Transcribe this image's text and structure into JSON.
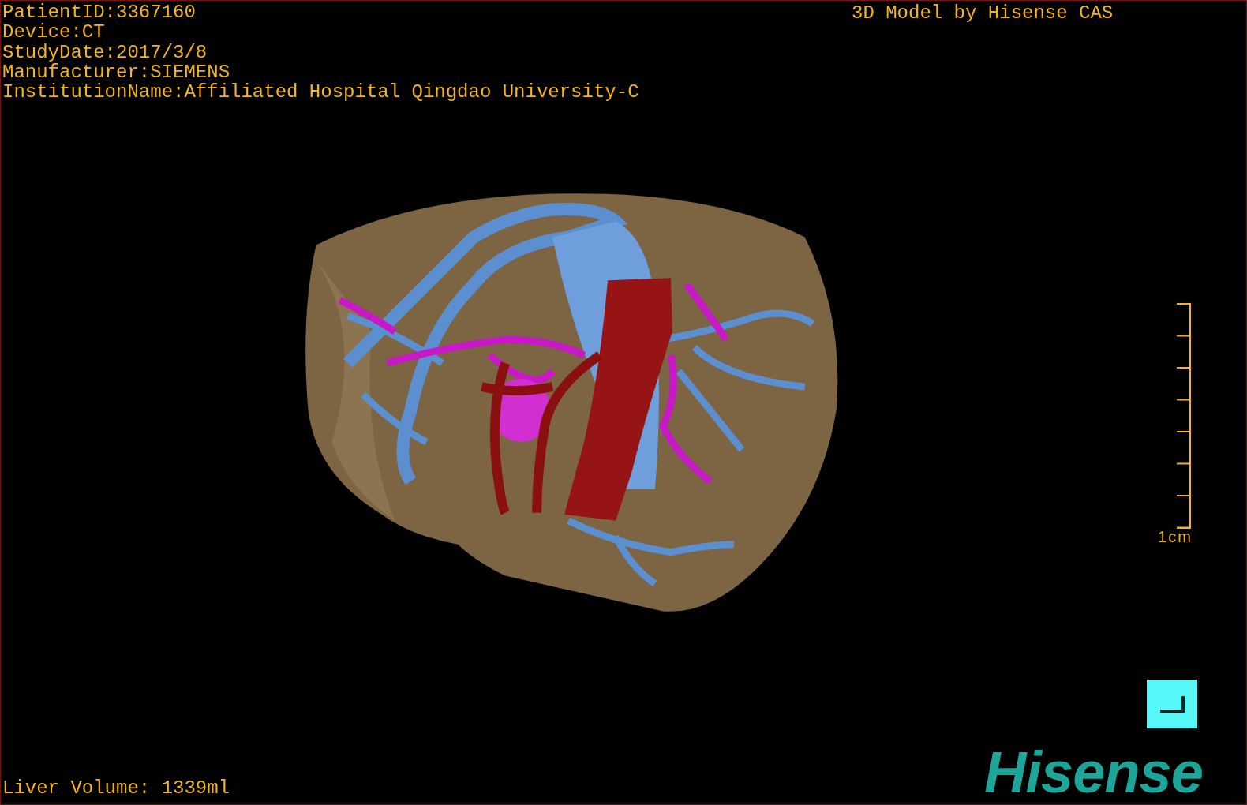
{
  "overlay_info": [
    "PatientID:3367160",
    "Device:CT",
    "StudyDate:2017/3/8",
    "Manufacturer:SIEMENS",
    "InstitutionName:Affiliated Hospital Qingdao University-C"
  ],
  "model_credit": "3D Model by Hisense CAS",
  "scale_bar": {
    "label": "1cm"
  },
  "liver_volume": "Liver Volume: 1339ml",
  "logo": "Hisense"
}
